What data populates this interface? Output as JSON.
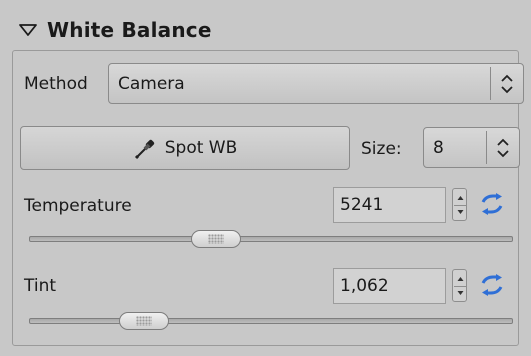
{
  "section": {
    "title": "White Balance",
    "collapse_icon": "triangle-down-icon"
  },
  "method": {
    "label": "Method",
    "value": "Camera"
  },
  "spot_wb": {
    "label": "Spot WB",
    "icon": "eyedropper-icon"
  },
  "size": {
    "label": "Size:",
    "value": "8"
  },
  "temperature": {
    "label": "Temperature",
    "value": "5241",
    "reset_icon": "reset-arrows-icon"
  },
  "tint": {
    "label": "Tint",
    "value": "1,062",
    "reset_icon": "reset-arrows-icon"
  },
  "colors": {
    "background": "#c8c8c8",
    "reset_icon_blue": "#2f6fd6"
  }
}
